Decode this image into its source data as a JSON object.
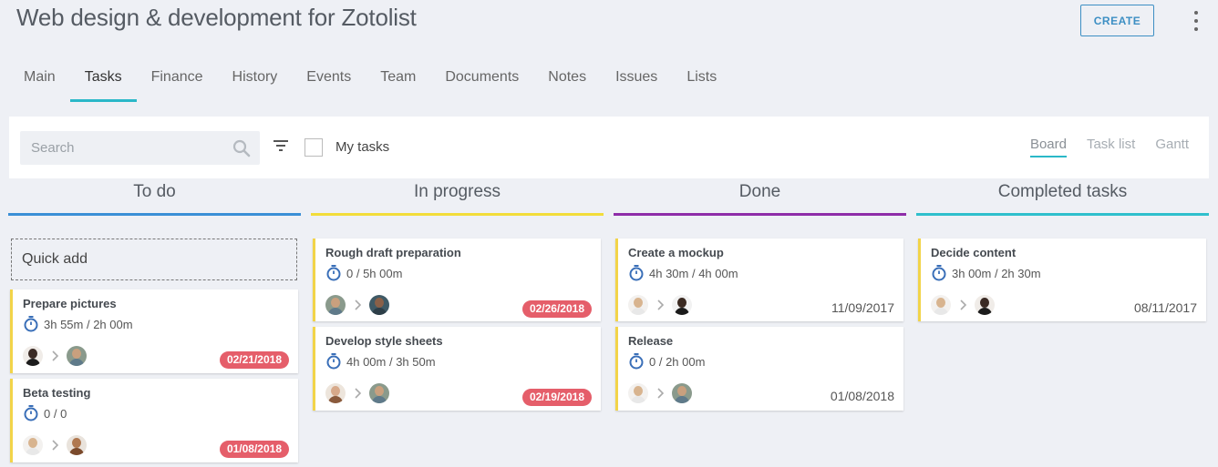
{
  "header": {
    "title": "Web design & development for Zotolist",
    "create_label": "CREATE"
  },
  "tabs": [
    "Main",
    "Tasks",
    "Finance",
    "History",
    "Events",
    "Team",
    "Documents",
    "Notes",
    "Issues",
    "Lists"
  ],
  "active_tab": "Tasks",
  "toolbar": {
    "search_placeholder": "Search",
    "my_tasks_label": "My tasks",
    "my_tasks_checked": false,
    "views": [
      "Board",
      "Task list",
      "Gantt"
    ],
    "active_view": "Board"
  },
  "columns": [
    {
      "title": "To do",
      "color": "#3a8fd6"
    },
    {
      "title": "In progress",
      "color": "#f2dd3a"
    },
    {
      "title": "Done",
      "color": "#8e2da8"
    },
    {
      "title": "Completed tasks",
      "color": "#2fbfcc"
    }
  ],
  "quick_add_label": "Quick add",
  "cards": {
    "todo": [
      {
        "name": "Prepare pictures",
        "time": "3h 55m / 2h 00m",
        "date": "02/21/2018",
        "overdue": true
      },
      {
        "name": "Beta testing",
        "time": "0 / 0",
        "date": "01/08/2018",
        "overdue": true
      }
    ],
    "progress": [
      {
        "name": "Rough draft preparation",
        "time": "0 / 5h 00m",
        "date": "02/26/2018",
        "overdue": true
      },
      {
        "name": "Develop style sheets",
        "time": "4h 00m / 3h 50m",
        "date": "02/19/2018",
        "overdue": true
      }
    ],
    "done": [
      {
        "name": "Create a mockup",
        "time": "4h 30m / 4h 00m",
        "date": "11/09/2017",
        "overdue": false
      },
      {
        "name": "Release",
        "time": "0 / 2h 00m",
        "date": "01/08/2018",
        "overdue": false
      }
    ],
    "completed": [
      {
        "name": "Decide content",
        "time": "3h 00m / 2h 30m",
        "date": "08/11/2017",
        "overdue": false
      }
    ]
  },
  "colors": {
    "accent": "#2ab8c8",
    "create_border": "#3d8fc4",
    "overdue_badge": "#e55e6a",
    "card_stripe": "#f2d449",
    "timer_icon": "#3a6fb8"
  },
  "icons": [
    "search-icon",
    "filter-icon",
    "more-vert-icon",
    "timer-icon",
    "chevron-right-icon",
    "avatar"
  ]
}
